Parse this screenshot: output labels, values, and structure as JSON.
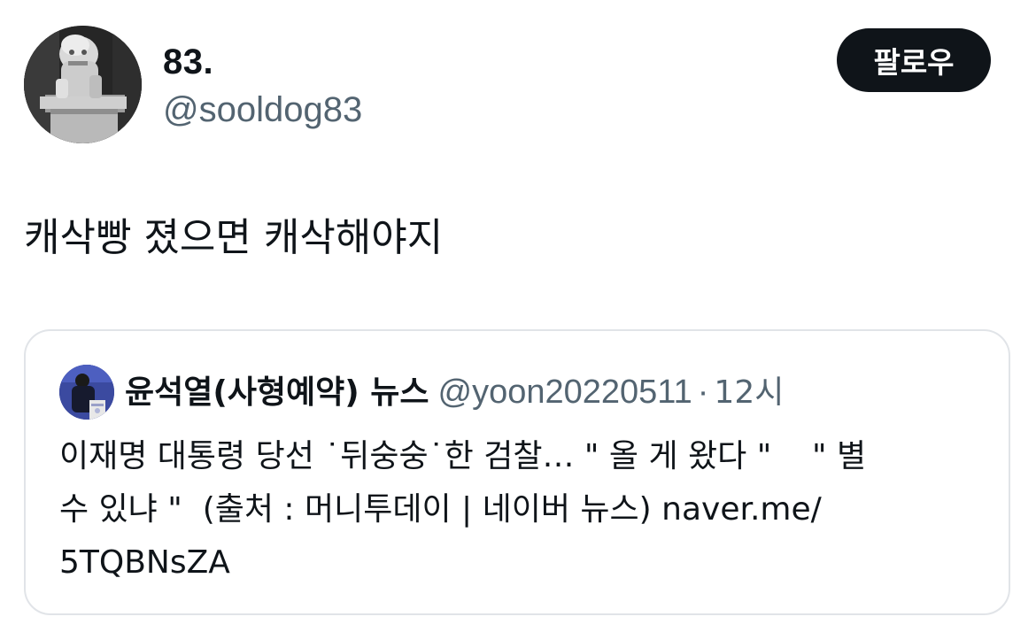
{
  "author": {
    "display_name": "83.",
    "handle": "@sooldog83",
    "avatar_icon": "stone-haetae-statue-avatar"
  },
  "follow_button": {
    "label": "팔로우",
    "background": "#0f1419",
    "text_color": "#ffffff"
  },
  "tweet": {
    "text": "캐삭빵 졌으면 캐삭해야지"
  },
  "quote": {
    "avatar_icon": "person-at-podium-avatar",
    "display_name": "윤석열(사형예약) 뉴스",
    "handle": "@yoon20220511",
    "separator": "·",
    "time": "12시",
    "body_lines": [
      "이재명 대통령 당선 ˙뒤숭숭˙한 검찰… \" 올 게 왔다 \"    \" 별",
      "수 있냐 \"  (출처 : 머니투데이 | 네이버 뉴스) naver.me/",
      "5TQBNsZA"
    ]
  },
  "colors": {
    "text_primary": "#0f1419",
    "text_secondary": "#536471",
    "border": "#e1e4e8",
    "background": "#ffffff"
  }
}
